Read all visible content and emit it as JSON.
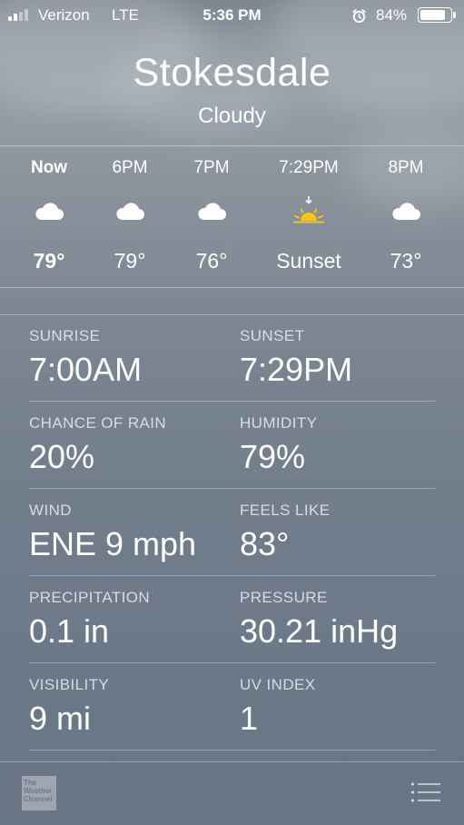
{
  "status_bar": {
    "carrier": "Verizon",
    "network": "LTE",
    "time": "5:36 PM",
    "battery": "84%",
    "battery_level": 0.84,
    "signal_bars": 2,
    "signal_total": 4,
    "icons": [
      "signal-icon",
      "alarm-icon",
      "battery-icon"
    ]
  },
  "header": {
    "city": "Stokesdale",
    "condition": "Cloudy"
  },
  "hourly": [
    {
      "time": "Now",
      "icon": "cloud-icon",
      "value": "79°",
      "bold": true
    },
    {
      "time": "6PM",
      "icon": "cloud-icon",
      "value": "79°",
      "bold": false
    },
    {
      "time": "7PM",
      "icon": "cloud-icon",
      "value": "76°",
      "bold": false
    },
    {
      "time": "7:29PM",
      "icon": "sunset-icon",
      "value": "Sunset",
      "bold": false
    },
    {
      "time": "8PM",
      "icon": "cloud-icon",
      "value": "73°",
      "bold": false
    }
  ],
  "details": {
    "sunrise_label": "SUNRISE",
    "sunrise_value": "7:00AM",
    "sunset_label": "SUNSET",
    "sunset_value": "7:29PM",
    "rain_label": "CHANCE OF RAIN",
    "rain_value": "20%",
    "humidity_label": "HUMIDITY",
    "humidity_value": "79%",
    "wind_label": "WIND",
    "wind_value": "ENE 9 mph",
    "feels_label": "FEELS LIKE",
    "feels_value": "83°",
    "precip_label": "PRECIPITATION",
    "precip_value": "0.1 in",
    "pressure_label": "PRESSURE",
    "pressure_value": "30.21 inHg",
    "visibility_label": "VISIBILITY",
    "visibility_value": "9 mi",
    "uv_label": "UV INDEX",
    "uv_value": "1"
  },
  "footer": {
    "logo_line1": "The",
    "logo_line2": "Weather",
    "logo_line3": "Channel",
    "logo_icon": "weather-channel-logo",
    "menu_icon": "list-icon"
  },
  "colors": {
    "sun": "#f5c518",
    "text": "#ffffff"
  }
}
